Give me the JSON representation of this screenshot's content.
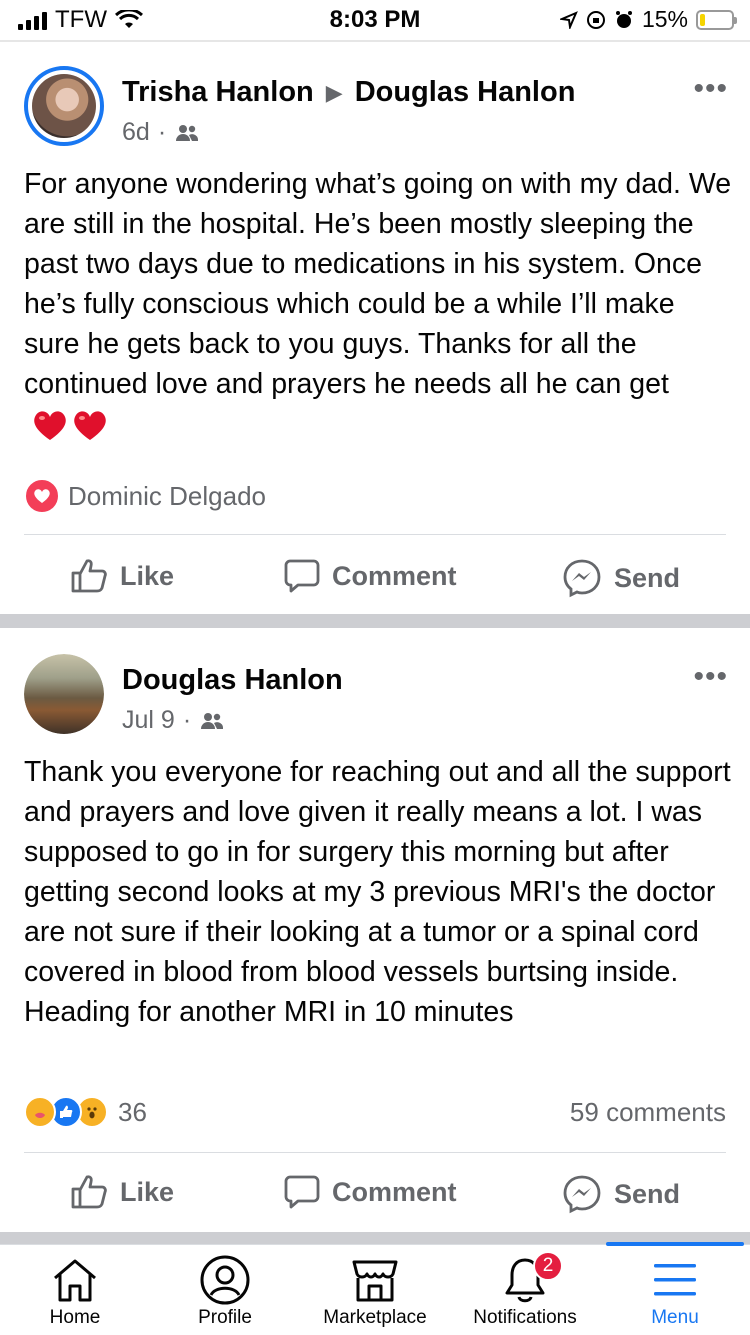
{
  "status_bar": {
    "carrier": "TFW",
    "time": "8:03 PM",
    "battery": "15%",
    "battery_level": 0.15
  },
  "posts": [
    {
      "author": "Trisha Hanlon",
      "target": "Douglas Hanlon",
      "time": "6d",
      "audience_icon": "friends-icon",
      "text": "For anyone wondering what’s going on with my dad. We are still in the hospital. He’s been mostly sleeping the past two days due to medications in his system. Once he’s fully conscious which could be a while I’ll make sure he gets back to you guys. Thanks for all the continued love and prayers he needs all he can get",
      "text_emoji": "heart-emoji x2",
      "reaction_name": "Dominic Delgado",
      "actions": {
        "like": "Like",
        "comment": "Comment",
        "send": "Send"
      }
    },
    {
      "author": "Douglas Hanlon",
      "time": "Jul 9",
      "audience_icon": "friends-icon",
      "text": "Thank you everyone for reaching out and all the support and prayers and love given it really means a lot. I was supposed to go in for surgery this morning but after getting second looks at my 3 previous MRI's the doctor are not sure if their looking at a tumor or a spinal cord covered in blood from blood vessels burtsing inside. Heading for another MRI in 10 minutes",
      "reaction_count": "36",
      "comments": "59 comments",
      "actions": {
        "like": "Like",
        "comment": "Comment",
        "send": "Send"
      }
    }
  ],
  "tabbar": {
    "home": "Home",
    "profile": "Profile",
    "marketplace": "Marketplace",
    "notifications": "Notifications",
    "notifications_badge": "2",
    "menu": "Menu"
  },
  "colors": {
    "accent": "#1877f2",
    "text_muted": "#65676b",
    "badge": "#e41e3f"
  }
}
